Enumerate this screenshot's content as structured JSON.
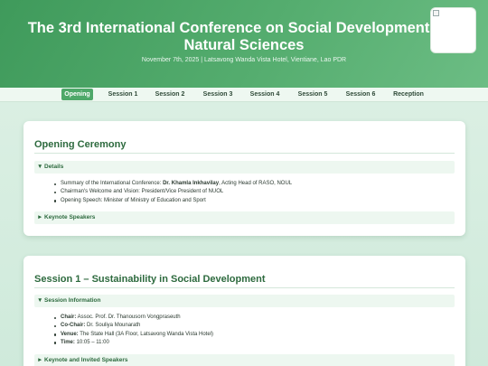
{
  "header": {
    "title": "The 3rd International Conference on Social Development and Natural Sciences",
    "subtitle": "November 7th, 2025 | Latsavong Wanda Vista Hotel, Vientiane, Lao PDR"
  },
  "nav": {
    "items": [
      "Opening",
      "Session 1",
      "Session 2",
      "Session 3",
      "Session 4",
      "Session 5",
      "Session 6",
      "Reception"
    ],
    "active": "Opening"
  },
  "opening": {
    "title": "Opening Ceremony",
    "details_label": "Details",
    "details_caret": "▼",
    "item1_prefix": "Summary of the International Conference: ",
    "item1_bold": "Dr. Khamla Inkhavilay",
    "item1_suffix": ", Acting Head of RASO, NOUL",
    "item2": "Chairman's Welcome and Vision: President/Vice President of NUOL",
    "item3": "Opening Speech: Minister of Ministry of Education and Sport",
    "keynote_label": "Keynote Speakers",
    "keynote_caret": "►"
  },
  "session1": {
    "title": "Session 1 – Sustainability in Social Development",
    "info_label": "Session Information",
    "info_caret": "▼",
    "chair_label": "Chair:",
    "chair_value": " Assoc. Prof. Dr. Thanousorn Vongpraseuth",
    "cochair_label": "Co-Chair:",
    "cochair_value": " Dr. Souliya Mounarath",
    "venue_label": "Venue:",
    "venue_value": " The State Hall (3A Floor, Latsavong Wanda Vista Hotel)",
    "time_label": "Time:",
    "time_value": " 10:05 – 11:00",
    "keynote_label": "Keynote and Invited Speakers",
    "keynote_caret": "►"
  },
  "colors": {
    "header": "#4ea869",
    "accent": "#2d6a3e",
    "nav_active": "#4ea869",
    "background": "#dff1e6"
  },
  "icons": {
    "expanded": "caret-down-icon",
    "collapsed": "caret-right-icon",
    "logo": "broken-image-icon"
  }
}
